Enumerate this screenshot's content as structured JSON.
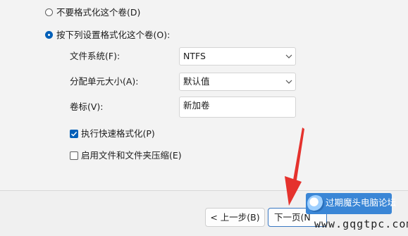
{
  "options": {
    "no_format_label": "不要格式化这个卷(D)",
    "format_label": "按下列设置格式化这个卷(O):"
  },
  "form": {
    "filesystem_label": "文件系统(F):",
    "filesystem_value": "NTFS",
    "alloc_label": "分配单元大小(A):",
    "alloc_value": "默认值",
    "volume_label": "卷标(V):",
    "volume_value": "新加卷",
    "quick_format_label": "执行快速格式化(P)",
    "compression_label": "启用文件和文件夹压缩(E)"
  },
  "footer": {
    "back_label": "< 上一步(B)",
    "next_label": "下一页(N"
  },
  "watermark": {
    "site_name": "过期魔头电脑论坛",
    "url": "www.gqgtpc.com"
  },
  "colors": {
    "accent": "#005fb8",
    "arrow": "#e5322d"
  }
}
